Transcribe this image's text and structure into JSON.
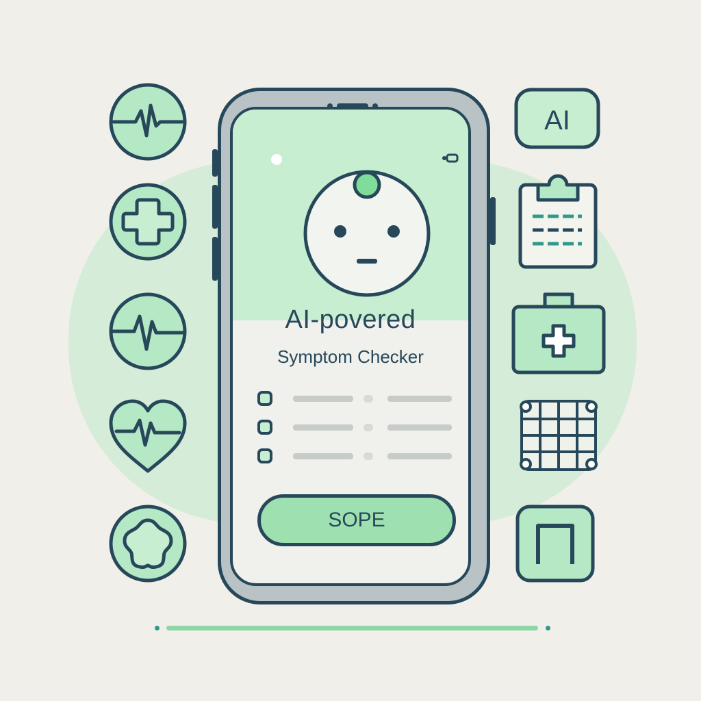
{
  "phone_screen": {
    "headline": "AI-povered",
    "subheading": "Symptom Checker",
    "option_count": 3,
    "action_button_label": "SOPE"
  },
  "right_icons": {
    "ai_badge_label": "AI"
  },
  "icons": {
    "left": [
      "heartbeat-circle-icon",
      "medical-cross-circle-icon",
      "pulse-circle-icon",
      "heart-pulse-icon",
      "badge-circle-icon"
    ],
    "right": [
      "ai-badge-icon",
      "clipboard-icon",
      "first-aid-kit-icon",
      "grid-calendar-icon",
      "frame-icon"
    ]
  },
  "colors": {
    "background": "#f1efe9",
    "accent_green": "#9fe0b0",
    "light_green": "#c8eed2",
    "outline_navy": "#26485a",
    "rule_teal": "#2f9a8a"
  }
}
